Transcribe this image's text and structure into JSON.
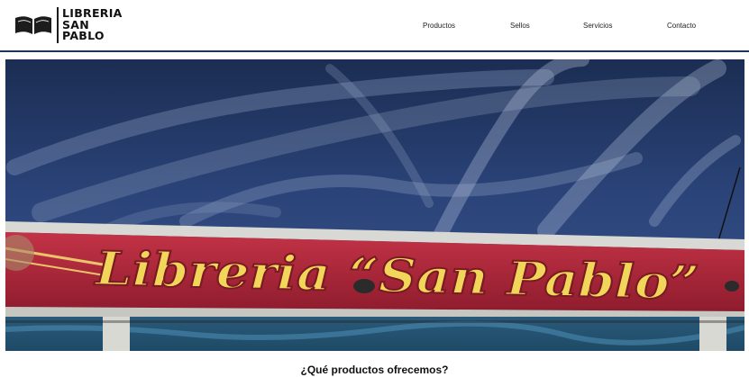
{
  "brand": {
    "line1": "LIBRERIA",
    "line2": "SAN",
    "line3": "PABLO"
  },
  "nav": {
    "productos": "Productos",
    "sellos": "Sellos",
    "servicios": "Servicios",
    "contacto": "Contacto"
  },
  "hero": {
    "sign_text": "Libreria “San Pablo”"
  },
  "section": {
    "title": "¿Qué productos ofrecemos?"
  },
  "colors": {
    "header_border": "#1f3556",
    "sky": "#233a66",
    "sign_red": "#b5283a",
    "sign_letters": "#f2d65a"
  }
}
